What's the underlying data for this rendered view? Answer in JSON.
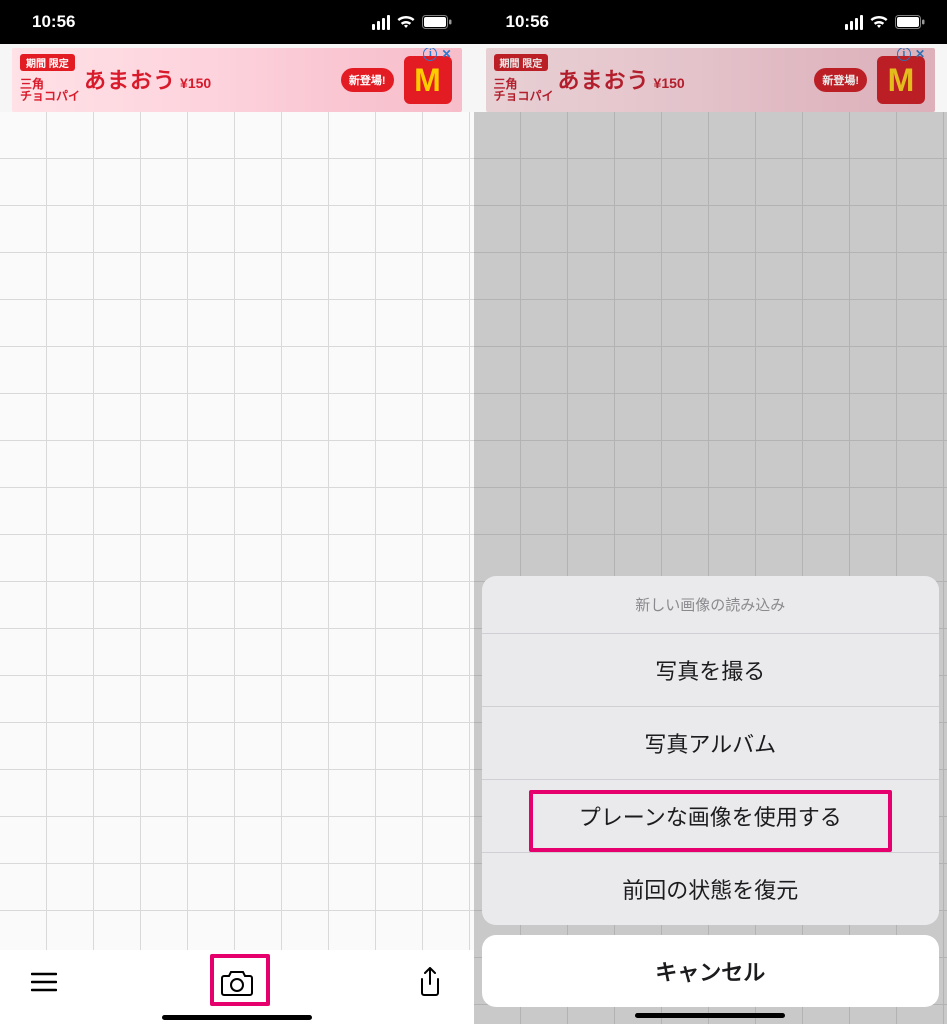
{
  "status": {
    "time": "10:56"
  },
  "ad": {
    "tag": "期間 限定",
    "line1": "三角\nチョコパイ",
    "main": "あまおう",
    "price": "¥150",
    "pill": "新登場!",
    "logo_letter": "M",
    "info_i": "i",
    "info_x": "✕"
  },
  "toolbar": {
    "menu": "menu",
    "camera": "camera",
    "share": "share"
  },
  "sheet": {
    "title": "新しい画像の読み込み",
    "items": [
      "写真を撮る",
      "写真アルバム",
      "プレーンな画像を使用する",
      "前回の状態を復元"
    ],
    "cancel": "キャンセル"
  }
}
